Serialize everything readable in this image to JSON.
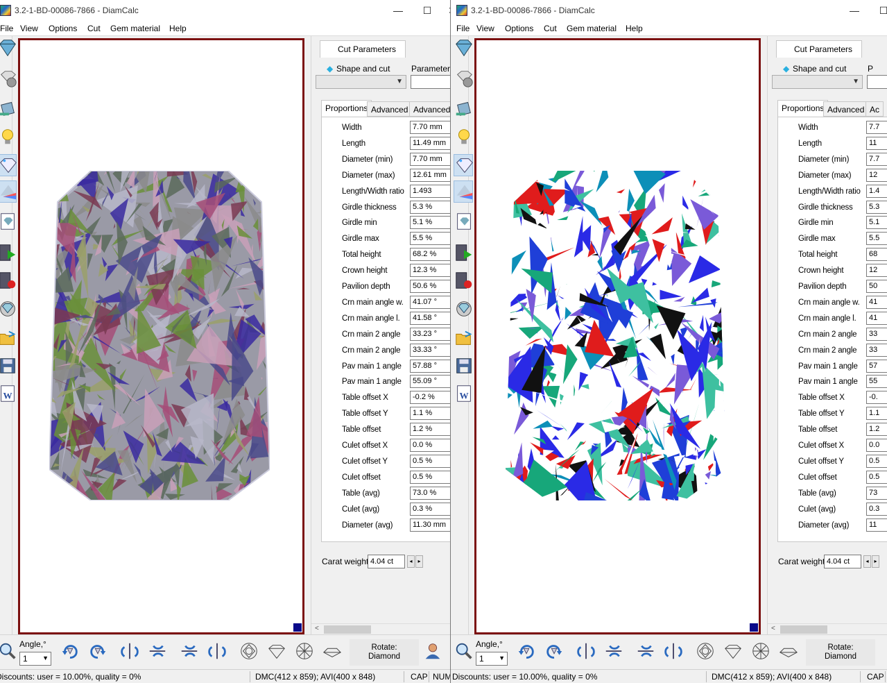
{
  "windows": [
    {
      "id": "left",
      "title": "3.2-1-BD-00086-7866 - DiamCalc",
      "menu": [
        "File",
        "View",
        "Options",
        "Cut",
        "Gem material",
        "Help"
      ],
      "cut_tab": "Cut Parameters",
      "shape_label": "Shape and cut",
      "param_label": "Parameters",
      "subtabs": [
        "Proportions",
        "Advanced",
        "Advanced"
      ],
      "properties": [
        {
          "name": "Width",
          "value": "7.70 mm"
        },
        {
          "name": "Length",
          "value": "11.49 mm"
        },
        {
          "name": "Diameter (min)",
          "value": "7.70 mm"
        },
        {
          "name": "Diameter (max)",
          "value": "12.61 mm"
        },
        {
          "name": "Length/Width ratio",
          "value": "1.493"
        },
        {
          "name": "Girdle thickness",
          "value": "5.3 %"
        },
        {
          "name": "Girdle min",
          "value": "5.1 %"
        },
        {
          "name": "Girdle max",
          "value": "5.5 %"
        },
        {
          "name": "Total height",
          "value": "68.2 %"
        },
        {
          "name": "Crown height",
          "value": "12.3 %"
        },
        {
          "name": "Pavilion depth",
          "value": "50.6 %"
        },
        {
          "name": "Crn main angle w.",
          "value": "41.07 °"
        },
        {
          "name": "Crn main angle l.",
          "value": "41.58 °"
        },
        {
          "name": "Crn main 2 angle",
          "value": "33.23 °"
        },
        {
          "name": "Crn main 2 angle",
          "value": "33.33 °"
        },
        {
          "name": "Pav main 1 angle",
          "value": "57.88 °"
        },
        {
          "name": "Pav main 1 angle",
          "value": "55.09 °"
        },
        {
          "name": "Table offset X",
          "value": "-0.2 %"
        },
        {
          "name": "Table offset Y",
          "value": "1.1 %"
        },
        {
          "name": "Table offset",
          "value": "1.2 %"
        },
        {
          "name": "Culet offset X",
          "value": "0.0 %"
        },
        {
          "name": "Culet offset Y",
          "value": "0.5 %"
        },
        {
          "name": "Culet offset",
          "value": "0.5 %"
        },
        {
          "name": "Table (avg)",
          "value": "73.0 %"
        },
        {
          "name": "Culet (avg)",
          "value": "0.3 %"
        },
        {
          "name": "Diameter (avg)",
          "value": "11.30 mm"
        }
      ],
      "carat_label": "Carat weight",
      "carat_value": "4.04 ct",
      "angle_label": "Angle,°",
      "angle_value": "1",
      "rotate_label": "Rotate:",
      "rotate_value": "Diamond",
      "status": {
        "discounts": "Discounts: user = 10.00%, quality = 0%",
        "dmc": "DMC(412 x 859); AVI(400 x 848)",
        "cap": "CAP",
        "num": "NUM"
      },
      "render_palette": [
        "#8b8b8b",
        "#a64e78",
        "#6a8f3a",
        "#3a2aa0",
        "#b7b7c9",
        "#7a3a52",
        "#5a6a5a",
        "#c9a0b8",
        "#4a4a8a",
        "#9aa06a"
      ]
    },
    {
      "id": "right",
      "title": "3.2-1-BD-00086-7866 - DiamCalc",
      "menu": [
        "File",
        "View",
        "Options",
        "Cut",
        "Gem material",
        "Help"
      ],
      "cut_tab": "Cut Parameters",
      "shape_label": "Shape and cut",
      "param_label": "P",
      "subtabs": [
        "Proportions",
        "Advanced",
        "Ac"
      ],
      "properties": [
        {
          "name": "Width",
          "value": "7.7"
        },
        {
          "name": "Length",
          "value": "11"
        },
        {
          "name": "Diameter (min)",
          "value": "7.7"
        },
        {
          "name": "Diameter (max)",
          "value": "12"
        },
        {
          "name": "Length/Width ratio",
          "value": "1.4"
        },
        {
          "name": "Girdle thickness",
          "value": "5.3"
        },
        {
          "name": "Girdle min",
          "value": "5.1"
        },
        {
          "name": "Girdle max",
          "value": "5.5"
        },
        {
          "name": "Total height",
          "value": "68"
        },
        {
          "name": "Crown height",
          "value": "12"
        },
        {
          "name": "Pavilion depth",
          "value": "50"
        },
        {
          "name": "Crn main angle w.",
          "value": "41"
        },
        {
          "name": "Crn main angle l.",
          "value": "41"
        },
        {
          "name": "Crn main 2 angle",
          "value": "33"
        },
        {
          "name": "Crn main 2 angle",
          "value": "33"
        },
        {
          "name": "Pav main 1 angle",
          "value": "57"
        },
        {
          "name": "Pav main 1 angle",
          "value": "55"
        },
        {
          "name": "Table offset X",
          "value": "-0."
        },
        {
          "name": "Table offset Y",
          "value": "1.1"
        },
        {
          "name": "Table offset",
          "value": "1.2"
        },
        {
          "name": "Culet offset X",
          "value": "0.0"
        },
        {
          "name": "Culet offset Y",
          "value": "0.5"
        },
        {
          "name": "Culet offset",
          "value": "0.5"
        },
        {
          "name": "Table (avg)",
          "value": "73"
        },
        {
          "name": "Culet (avg)",
          "value": "0.3"
        },
        {
          "name": "Diameter (avg)",
          "value": "11"
        }
      ],
      "carat_label": "Carat weight",
      "carat_value": "4.04 ct",
      "angle_label": "Angle,°",
      "angle_value": "1",
      "rotate_label": "Rotate:",
      "rotate_value": "Diamond",
      "status": {
        "discounts": "Discounts: user = 10.00%, quality = 0%",
        "dmc": "DMC(412 x 859); AVI(400 x 848)",
        "cap": "CAP",
        "num": ""
      },
      "render_palette": [
        "#ffffff",
        "#1f3fd8",
        "#17a77a",
        "#7a5ad8",
        "#0d8fb8",
        "#111111",
        "#e01c1c",
        "#2a2ae6",
        "#3ec0a0",
        "#ffffff"
      ]
    }
  ]
}
